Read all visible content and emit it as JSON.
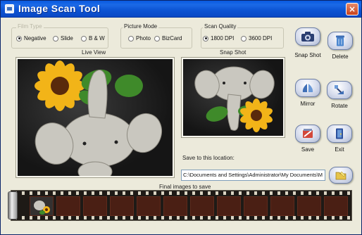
{
  "window": {
    "title": "Image Scan Tool",
    "close_glyph": "×"
  },
  "film_type": {
    "label": "Film Type",
    "options": [
      {
        "label": "Negative",
        "selected": true
      },
      {
        "label": "Slide",
        "selected": false
      },
      {
        "label": "B & W",
        "selected": false
      }
    ]
  },
  "picture_mode": {
    "label": "Picture Mode",
    "options": [
      {
        "label": "Photo",
        "selected": false
      },
      {
        "label": "BizCard",
        "selected": false
      }
    ]
  },
  "scan_quality": {
    "label": "Scan Quality",
    "options": [
      {
        "label": "1800 DPI",
        "selected": true
      },
      {
        "label": "3600 DPI",
        "selected": false
      }
    ]
  },
  "live_view": {
    "label": "Live  View"
  },
  "snap_shot": {
    "label": "Snap Shot"
  },
  "buttons": {
    "snap_shot": {
      "label": "Snap Shot",
      "icon": "camera-icon"
    },
    "delete": {
      "label": "Delete",
      "icon": "trash-icon"
    },
    "mirror": {
      "label": "Mirror",
      "icon": "mirror-icon"
    },
    "rotate": {
      "label": "Rotate",
      "icon": "rotate-icon"
    },
    "save": {
      "label": "Save",
      "icon": "save-icon"
    },
    "exit": {
      "label": "Exit",
      "icon": "exit-icon"
    },
    "browse": {
      "icon": "folder-icon"
    }
  },
  "save_location": {
    "label": "Save to this location:",
    "value": "C:\\Documents and Settings\\Administrator\\My Documents\\M"
  },
  "final_images": {
    "label": "Final images to save",
    "thumbnail_count": 1
  },
  "colors": {
    "accent": "#0a5ae0",
    "button_face": "#d6dced",
    "window_bg": "#eceadb"
  }
}
